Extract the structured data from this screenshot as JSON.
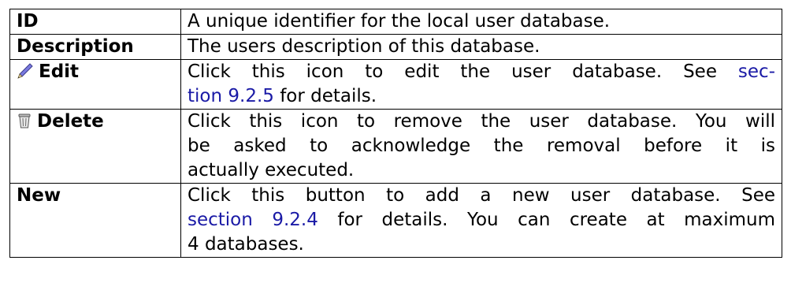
{
  "rows": [
    {
      "term": "ID",
      "desc_lines": [
        "A unique identifier for the local user database."
      ]
    },
    {
      "term": "Description",
      "desc_lines": [
        "The users description of this database."
      ]
    },
    {
      "term": "Edit",
      "icon": "pencil-icon",
      "desc_line1_pre": "Click this icon to edit the user database.  See ",
      "desc_line1_link": "sec-",
      "desc_line2_link": "tion 9.2.5",
      "desc_line2_post": " for details."
    },
    {
      "term": "Delete",
      "icon": "trash-icon",
      "desc_lines": [
        "Click this icon to remove the user database. You will",
        "be asked to acknowledge the removal before it is",
        "actually executed."
      ]
    },
    {
      "term": "New",
      "desc_line1": "Click this button to add a new user database.  See",
      "desc_line2_link": "section 9.2.4",
      "desc_line2_post": " for details. You can create at maximum",
      "desc_line3": "4 databases."
    }
  ],
  "colors": {
    "link": "#1a1aa6",
    "border": "#000000",
    "pencil_body": "#7a7ae0",
    "trash": "#6a6a6a"
  }
}
